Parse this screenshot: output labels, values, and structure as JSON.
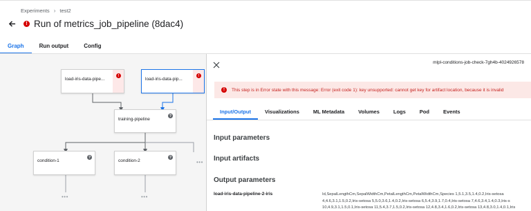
{
  "breadcrumb": {
    "items": [
      "Experiments",
      "test2"
    ],
    "separator": "›"
  },
  "header": {
    "title": "Run of metrics_job_pipeline (8dac4)",
    "status_glyph": "!"
  },
  "tabs": [
    {
      "label": "Graph",
      "active": true
    },
    {
      "label": "Run output",
      "active": false
    },
    {
      "label": "Config",
      "active": false
    }
  ],
  "graph": {
    "nodes": [
      {
        "label": "load-iris-data-pipe...",
        "status": "error"
      },
      {
        "label": "load-iris-data-pip...",
        "status": "error",
        "selected": true
      },
      {
        "label": "training-pipeline",
        "status": "unknown"
      },
      {
        "label": "condition-1",
        "status": "unknown"
      },
      {
        "label": "condition-2",
        "status": "unknown"
      }
    ],
    "more_glyph": "•••"
  },
  "panel": {
    "run_id": "mlpl-conditions-job-check-7gh4b-4024926578",
    "error_message": "This step is in Error state with this message: Error (exit code 1): key unsupported: cannot get key for artifact location, because it is invalid",
    "tabs": [
      {
        "label": "Input/Output",
        "active": true
      },
      {
        "label": "Visualizations",
        "active": false
      },
      {
        "label": "ML Metadata",
        "active": false
      },
      {
        "label": "Volumes",
        "active": false
      },
      {
        "label": "Logs",
        "active": false
      },
      {
        "label": "Pod",
        "active": false
      },
      {
        "label": "Events",
        "active": false
      }
    ],
    "sections": {
      "input_parameters": "Input parameters",
      "input_artifacts": "Input artifacts",
      "output_parameters": "Output parameters"
    },
    "output_param": {
      "key": "load-iris-data-pipeline-2-iris",
      "value_lines": [
        "Id,SepalLengthCm,SepalWidthCm,PetalLengthCm,PetalWidthCm,Species 1,5.1,3.5,1.4,0.2,Iris-setosa",
        "4,4.6,3.1,1.5,0.2,Iris-setosa 5,5.0,3.6,1.4,0.2,Iris-setosa 6,5.4,3.9,1.7,0.4,Iris-setosa 7,4.6,3.4,1.4,0.3,Iris-s",
        "10,4.9,3.1,1.5,0.1,Iris-setosa 11,5.4,3.7,1.5,0.2,Iris-setosa 12,4.8,3.4,1.6,0.2,Iris-setosa 13,4.8,3.0,1.4,0.1,Iris"
      ]
    }
  },
  "colors": {
    "accent": "#1a73e8",
    "error": "#d50000",
    "error_bg": "#fce8e6",
    "graph_bg": "#f5f5f5"
  }
}
